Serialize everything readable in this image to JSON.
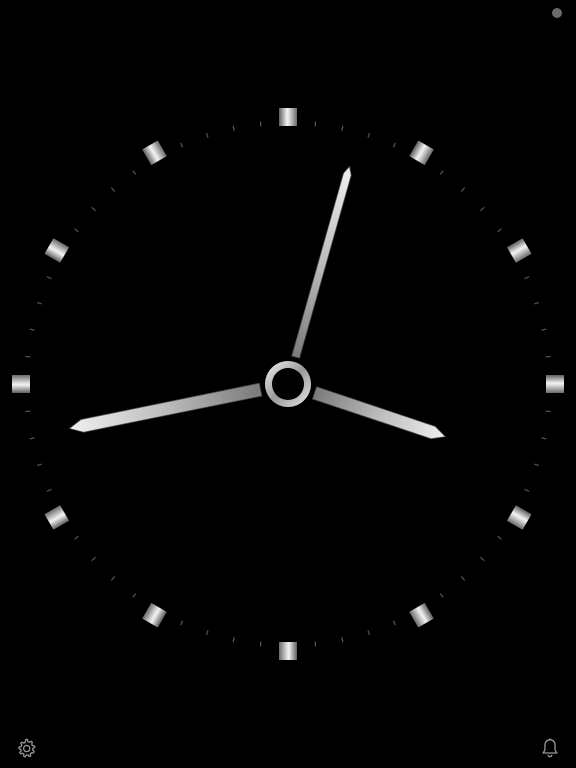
{
  "clock": {
    "time": {
      "hours": 3,
      "minutes": 5,
      "seconds": 43
    },
    "hour_markers": 12,
    "minute_ticks": 60
  },
  "colors": {
    "background": "#000000",
    "hands_light": "#e6e6e6",
    "hands_dark": "#6f6f6f",
    "tick_color": "#555555",
    "status_dot": "#6a6a6a",
    "icon_color": "#9a9a9a"
  },
  "icons": {
    "settings": "gear-icon",
    "alarm": "bell-icon",
    "status": "status-dot-icon"
  }
}
